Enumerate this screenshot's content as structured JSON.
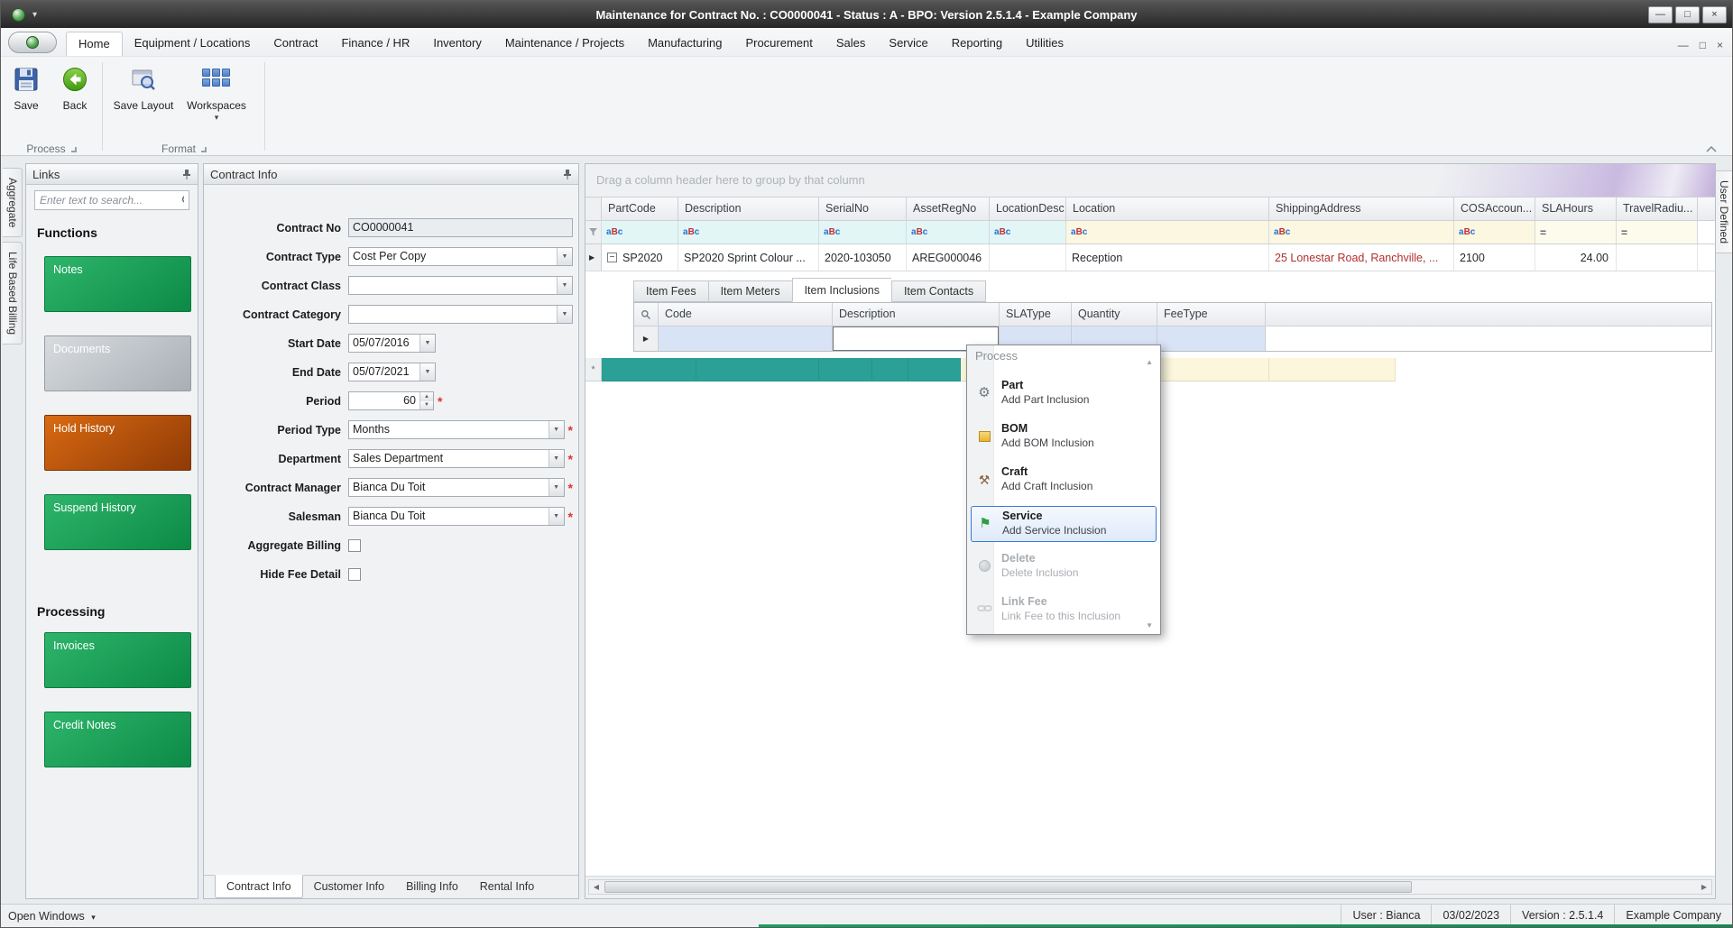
{
  "colors": {
    "teal_row": "#2aa096",
    "selection_blue": "#3a78d4",
    "button_green": "#0c8a46",
    "button_orange": "#8f3a06",
    "button_gray": "#a9aeb5",
    "required_red": "#e03030",
    "address_red": "#b03030",
    "bottom_accent_green": "#17a05e"
  },
  "window": {
    "title": "Maintenance for Contract No. : CO0000041 - Status : A - BPO: Version 2.5.1.4 - Example Company"
  },
  "menu_tabs": {
    "active": "Home",
    "items": [
      "Home",
      "Equipment / Locations",
      "Contract",
      "Finance / HR",
      "Inventory",
      "Maintenance / Projects",
      "Manufacturing",
      "Procurement",
      "Sales",
      "Service",
      "Reporting",
      "Utilities"
    ]
  },
  "ribbon": {
    "save": "Save",
    "back": "Back",
    "save_layout": "Save Layout",
    "workspaces": "Workspaces",
    "group_process": "Process",
    "group_format": "Format"
  },
  "side_tabs": {
    "left": [
      "Aggregate",
      "Life Based Billing"
    ],
    "right": [
      "User Defined"
    ]
  },
  "links": {
    "title": "Links",
    "search_placeholder": "Enter text to search...",
    "functions_heading": "Functions",
    "processing_heading": "Processing",
    "function_buttons": [
      {
        "label": "Notes",
        "style": "green"
      },
      {
        "label": "Documents",
        "style": "gray"
      },
      {
        "label": "Hold History",
        "style": "orange"
      },
      {
        "label": "Suspend History",
        "style": "green"
      }
    ],
    "processing_buttons": [
      {
        "label": "Invoices",
        "style": "green"
      },
      {
        "label": "Credit Notes",
        "style": "green"
      }
    ]
  },
  "contract": {
    "title": "Contract Info",
    "fields": [
      {
        "label": "Contract No",
        "value": "CO0000041",
        "control": "text",
        "required": false
      },
      {
        "label": "Contract Type",
        "value": "Cost Per Copy",
        "control": "select",
        "required": false
      },
      {
        "label": "Contract Class",
        "value": "",
        "control": "select",
        "required": false
      },
      {
        "label": "Contract Category",
        "value": "",
        "control": "select",
        "required": false
      },
      {
        "label": "Start Date",
        "value": "05/07/2016",
        "control": "date",
        "required": false
      },
      {
        "label": "End Date",
        "value": "05/07/2021",
        "control": "date",
        "required": false
      },
      {
        "label": "Period",
        "value": "60",
        "control": "spin",
        "required": true
      },
      {
        "label": "Period Type",
        "value": "Months",
        "control": "select",
        "required": true
      },
      {
        "label": "Department",
        "value": "Sales Department",
        "control": "select",
        "required": true
      },
      {
        "label": "Contract Manager",
        "value": "Bianca Du Toit",
        "control": "select",
        "required": true
      },
      {
        "label": "Salesman",
        "value": "Bianca Du Toit",
        "control": "select",
        "required": true
      },
      {
        "label": "Aggregate Billing",
        "control": "checkbox",
        "checked": false
      },
      {
        "label": "Hide Fee Detail",
        "control": "checkbox",
        "checked": false
      }
    ],
    "tabs": [
      "Contract Info",
      "Customer Info",
      "Billing Info",
      "Rental Info"
    ],
    "active_tab": "Contract Info"
  },
  "grid": {
    "group_hint": "Drag a column header here to group by that column",
    "columns": [
      {
        "label": "PartCode",
        "filter": "abc"
      },
      {
        "label": "Description",
        "filter": "abc"
      },
      {
        "label": "SerialNo",
        "filter": "abc"
      },
      {
        "label": "AssetRegNo",
        "filter": "abc"
      },
      {
        "label": "LocationDesc",
        "filter": "abc"
      },
      {
        "label": "Location",
        "filter": "abc"
      },
      {
        "label": "ShippingAddress",
        "filter": "abc"
      },
      {
        "label": "COSAccoun...",
        "filter": "abc"
      },
      {
        "label": "SLAHours",
        "filter": "eq"
      },
      {
        "label": "TravelRadiu...",
        "filter": "eq"
      }
    ],
    "row_values": [
      "SP2020",
      "SP2020 Sprint Colour ...",
      "2020-103050",
      "AREG000046",
      "",
      "Reception",
      "25 Lonestar Road, Ranchville, ...",
      "2100",
      "24.00",
      ""
    ],
    "detail": {
      "tabs": [
        "Item Fees",
        "Item Meters",
        "Item Inclusions",
        "Item Contacts"
      ],
      "active_tab": "Item Inclusions",
      "columns": [
        "Code",
        "Description",
        "SLAType",
        "Quantity",
        "FeeType"
      ]
    }
  },
  "context_menu": {
    "title": "Process",
    "items": [
      {
        "title": "Part",
        "subtitle": "Add Part Inclusion",
        "icon": "gear-icon",
        "state": "normal"
      },
      {
        "title": "BOM",
        "subtitle": "Add BOM Inclusion",
        "icon": "box-icon",
        "state": "normal"
      },
      {
        "title": "Craft",
        "subtitle": "Add Craft Inclusion",
        "icon": "tools-icon",
        "state": "normal"
      },
      {
        "title": "Service",
        "subtitle": "Add Service Inclusion",
        "icon": "flag-icon",
        "state": "selected"
      },
      {
        "title": "Delete",
        "subtitle": "Delete Inclusion",
        "icon": "sphere-icon",
        "state": "disabled"
      },
      {
        "title": "Link Fee",
        "subtitle": "Link Fee to this Inclusion",
        "icon": "link-icon",
        "state": "disabled"
      }
    ]
  },
  "status_bar": {
    "open_windows": "Open Windows",
    "items": [
      "User : Bianca",
      "03/02/2023",
      "Version : 2.5.1.4",
      "Example Company"
    ]
  }
}
